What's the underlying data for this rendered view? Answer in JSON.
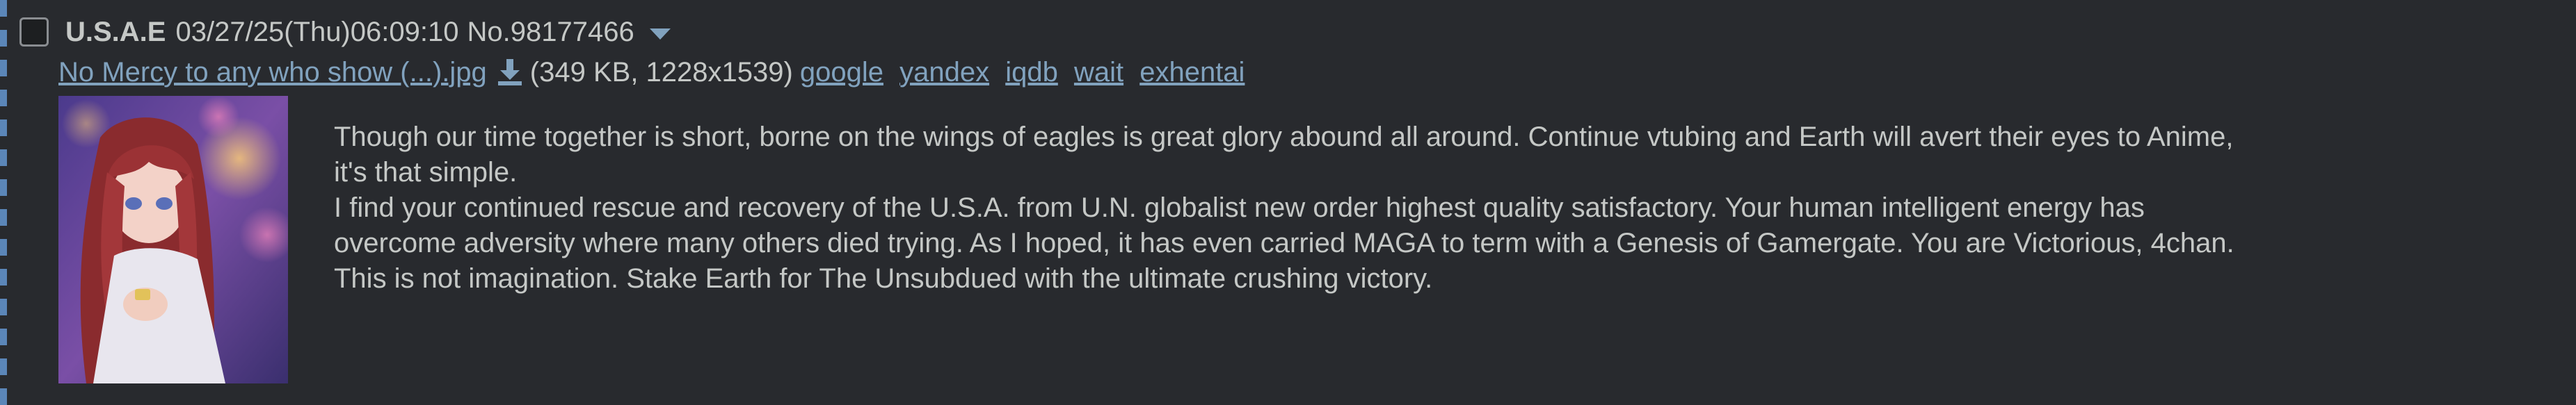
{
  "post": {
    "name": "U.S.A.E",
    "date": "03/27/25(Thu)06:09:10",
    "number": "No.98177466"
  },
  "file": {
    "filename": "No Mercy to any who show (...).jpg",
    "meta": "(349 KB, 1228x1539)",
    "search_links": [
      "google",
      "yandex",
      "iqdb",
      "wait",
      "exhentai"
    ]
  },
  "message": {
    "lines": [
      "Though our time together is short, borne on the wings of eagles is great glory abound all around. Continue vtubing and Earth will avert their eyes to Anime,",
      "it's that simple.",
      "I find your continued rescue and recovery of the U.S.A. from U.N. globalist new order highest quality satisfactory. Your human intelligent energy has",
      "overcome adversity where many others died trying. As I hoped, it has even carried MAGA to term with a Genesis of Gamergate. You are Victorious, 4chan.",
      "This is not imagination. Stake Earth for The Unsubdued with the ultimate crushing victory."
    ]
  },
  "colors": {
    "background": "#282a2e",
    "text": "#c5c8c6",
    "link": "#81a2be",
    "dash_marker": "#5b86b8"
  },
  "icons": {
    "select": "checkbox-icon",
    "menu": "chevron-down-icon",
    "download": "download-icon"
  }
}
